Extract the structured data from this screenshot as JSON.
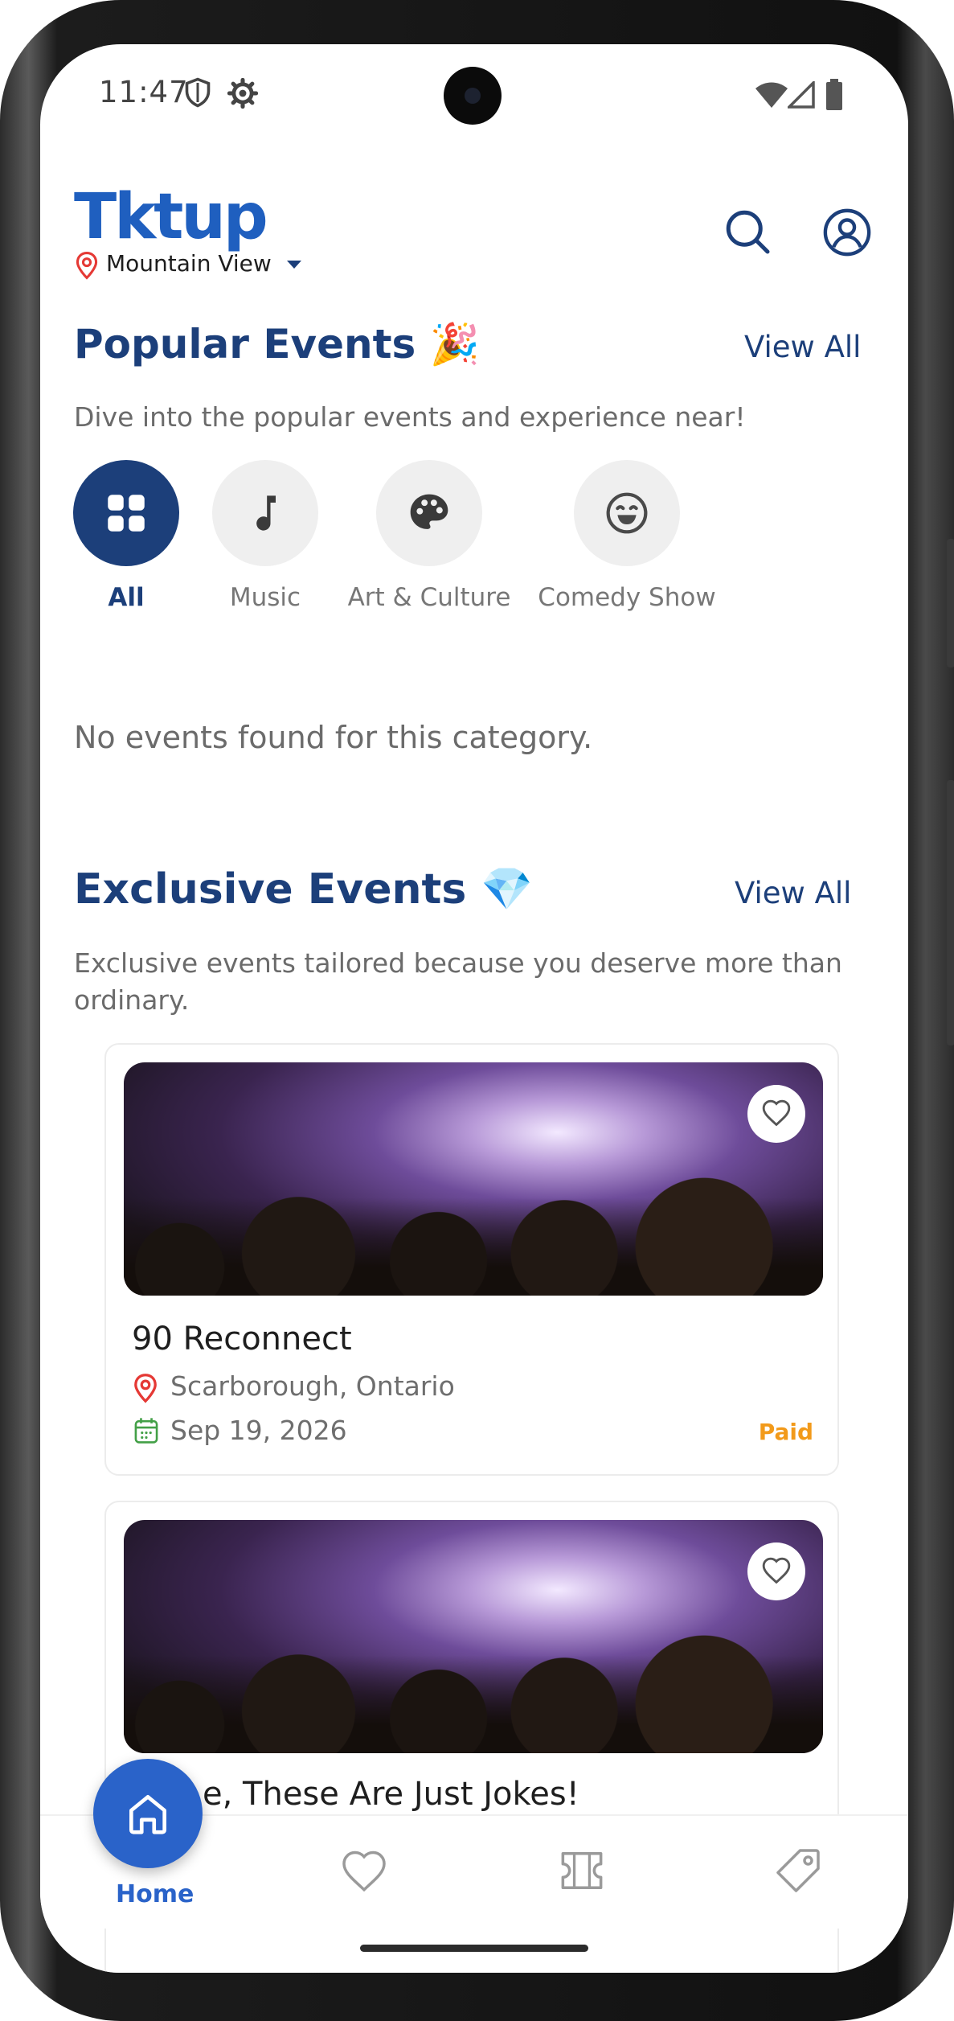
{
  "status_bar": {
    "time": "11:47",
    "icons": [
      "shield-icon",
      "gear-icon",
      "wifi-icon",
      "cellular-icon",
      "battery-icon"
    ]
  },
  "header": {
    "logo_text": "Tktup",
    "location": "Mountain View"
  },
  "popular": {
    "title": "Popular Events 🎉",
    "view_all": "View All",
    "subtitle": "Dive into the popular events and experience near!",
    "categories": [
      {
        "label": "All",
        "icon": "grid-icon",
        "active": true
      },
      {
        "label": "Music",
        "icon": "music-note-icon",
        "active": false
      },
      {
        "label": "Art & Culture",
        "icon": "palette-icon",
        "active": false
      },
      {
        "label": "Comedy Show",
        "icon": "smile-icon",
        "active": false
      }
    ],
    "empty_message": "No events found for this category."
  },
  "exclusive": {
    "title": "Exclusive Events 💎",
    "view_all": "View All",
    "subtitle": "Exclusive events tailored because you deserve more than ordinary.",
    "events": [
      {
        "title": "90 Reconnect",
        "location": "Scarborough, Ontario",
        "date": "Sep 19, 2026",
        "price": "Paid"
      },
      {
        "title": "e, These Are Just Jokes!"
      }
    ]
  },
  "bottom_nav": {
    "home_label": "Home",
    "items": [
      "home-icon",
      "heart-icon",
      "ticket-icon",
      "tag-icon"
    ]
  },
  "colors": {
    "primary": "#1c3f7a",
    "accent": "#2a63c9",
    "paid": "#f29a1a",
    "location_pin": "#e53935",
    "calendar": "#43a047"
  }
}
